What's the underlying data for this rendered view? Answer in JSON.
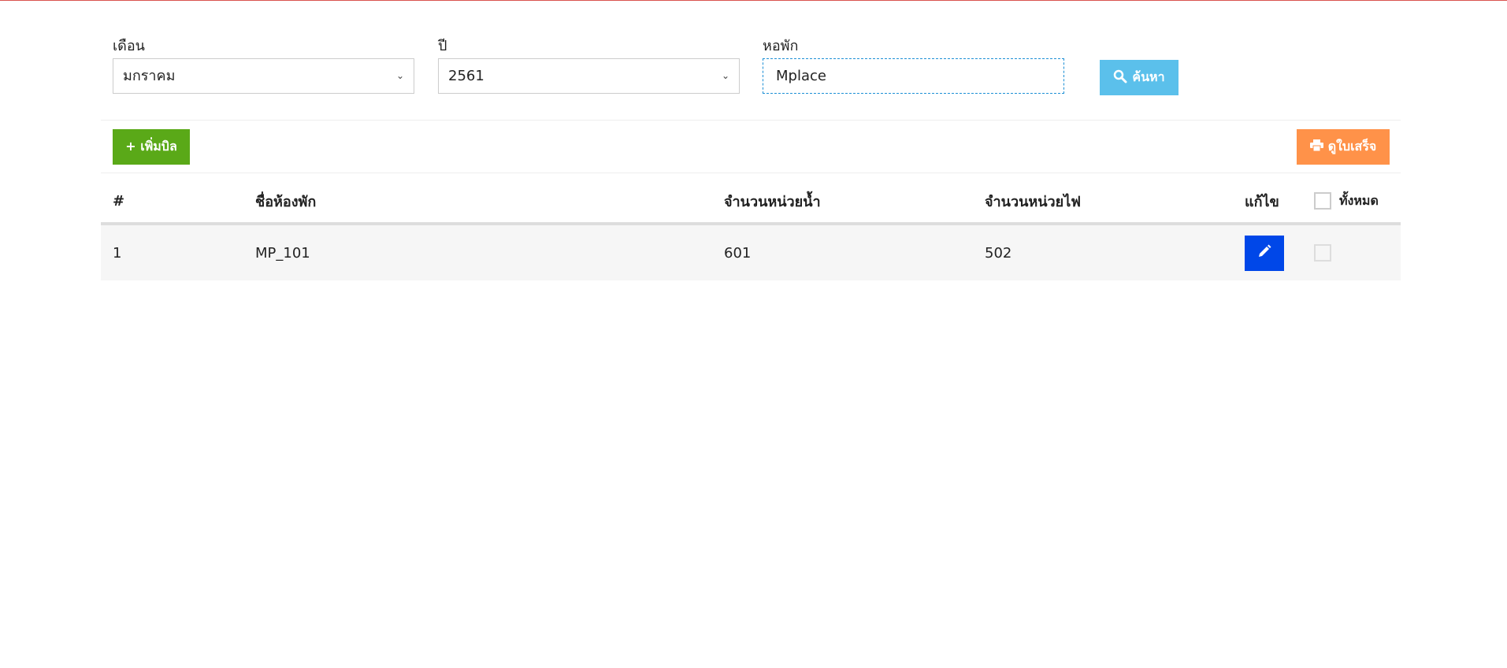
{
  "filters": {
    "month": {
      "label": "เดือน",
      "value": "มกราคม"
    },
    "year": {
      "label": "ปี",
      "value": "2561"
    },
    "dorm": {
      "label": "หอพัก",
      "value": "Mplace"
    },
    "search_button": "ค้นหา"
  },
  "toolbar": {
    "add_bill_button": "+ เพิ่มบิล",
    "view_receipt_button": "ดูใบเสร็จ"
  },
  "table": {
    "headers": {
      "index": "#",
      "room_name": "ชื่อห้องพัก",
      "water_units": "จำนวนหน่วยน้ำ",
      "electric_units": "จำนวนหน่วยไฟ",
      "edit": "แก้ไข",
      "select_all": "ทั้งหมด"
    },
    "rows": [
      {
        "index": "1",
        "room_name": "MP_101",
        "water_units": "601",
        "electric_units": "502"
      }
    ]
  },
  "colors": {
    "search_button": "#5bc0eb",
    "add_button": "#5aa918",
    "receipt_button": "#ff9249",
    "edit_button": "#0047e8"
  },
  "icons": {
    "search": "search-icon",
    "print": "printer-icon",
    "edit": "pencil-icon",
    "dropdown": "chevron-down-icon"
  }
}
